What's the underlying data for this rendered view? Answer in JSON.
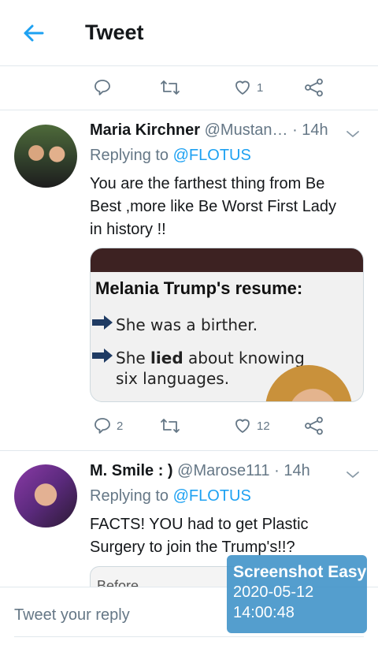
{
  "header": {
    "title": "Tweet"
  },
  "top_actions": {
    "like_count": "1"
  },
  "tweets": [
    {
      "name": "Maria Kirchner",
      "handle": "@Mustan…",
      "time": "· 14h",
      "replying_prefix": "Replying to ",
      "replying_to": "@FLOTUS",
      "text_lines": [
        "You are the farthest thing from Be",
        "Best ,more like Be Worst First Lady",
        "in history !!"
      ],
      "media": {
        "heading": "Melania Trump's resume:",
        "line1": "She was a birther.",
        "line2_pre": "She ",
        "line2_bold": "lied",
        "line2_post": " about knowing",
        "line3": "six languages."
      },
      "reply_count": "2",
      "like_count": "12"
    },
    {
      "name": "M. Smile : )",
      "handle": "@Marose111",
      "time": "· 14h",
      "replying_prefix": "Replying to ",
      "replying_to": "@FLOTUS",
      "text_lines": [
        "FACTS! YOU had to get Plastic",
        "Surgery to join the Trump's!!?"
      ],
      "media_label": "Before"
    }
  ],
  "reply_bar": {
    "placeholder": "Tweet your reply"
  },
  "watermark": {
    "title": "Screenshot Easy",
    "date": "2020-05-12",
    "time": "14:00:48"
  },
  "colors": {
    "accent": "#1da1f2",
    "muted": "#657786",
    "divider": "#e1e8ed"
  },
  "icons": [
    "back-arrow-icon",
    "reply-icon",
    "retweet-icon",
    "like-icon",
    "share-icon",
    "chevron-down-icon"
  ]
}
